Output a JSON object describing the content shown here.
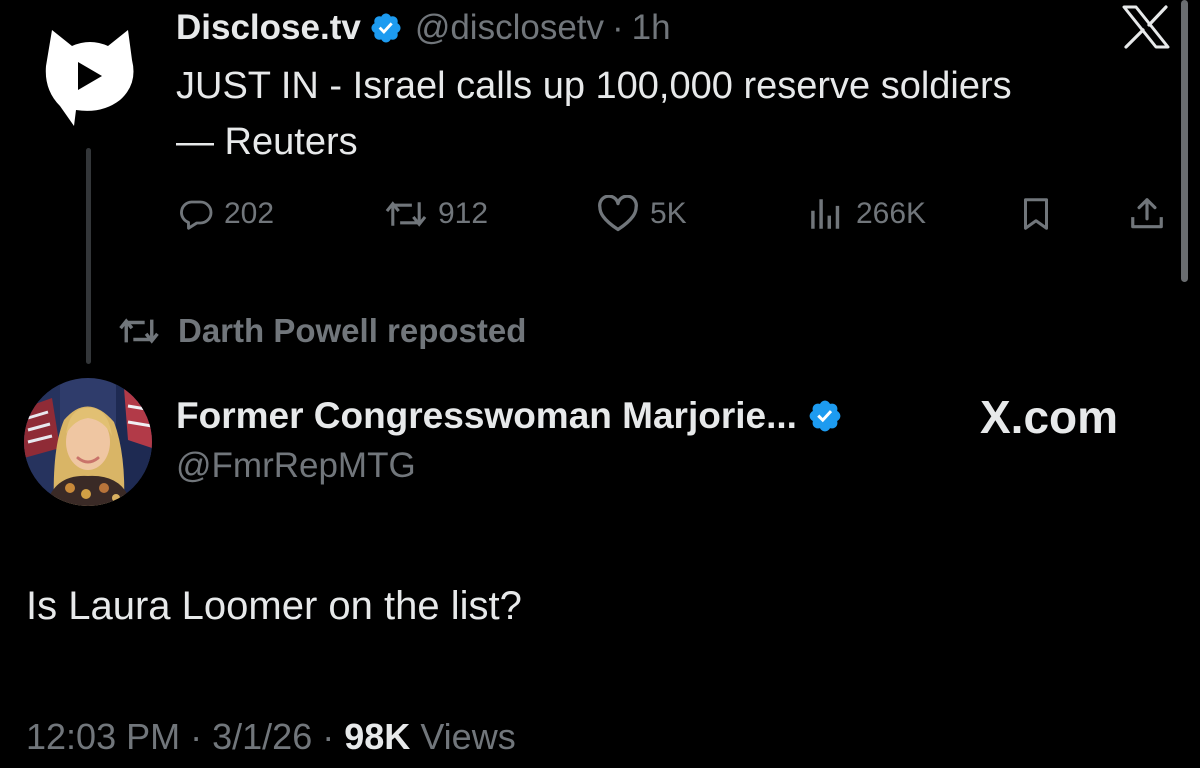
{
  "quoted_tweet": {
    "author_name": "Disclose.tv",
    "handle": "@disclosetv",
    "separator": "·",
    "time_ago": "1h",
    "text_line1": "JUST IN - Israel calls up 100,000 reserve soldiers",
    "text_line2": "— Reuters",
    "stats": {
      "replies": "202",
      "reposts": "912",
      "likes": "5K",
      "views": "266K"
    },
    "icons": [
      "disclose-logo",
      "verified-badge-icon",
      "x-logo-icon",
      "reply-icon",
      "repost-icon",
      "like-icon",
      "views-icon",
      "bookmark-icon",
      "share-icon"
    ]
  },
  "repost_banner": {
    "text": "Darth Powell reposted"
  },
  "main_tweet": {
    "author_name": "Former Congresswoman Marjorie...",
    "handle": "@FmrRepMTG",
    "brand_label": "X.com",
    "text": "Is Laura Loomer on the list?",
    "time": "12:03 PM",
    "date": "3/1/26",
    "separator": "·",
    "views_count": "98K",
    "views_label": "Views"
  },
  "colors": {
    "background": "#000000",
    "primary_text": "#e7e9ea",
    "secondary_text": "#71767b",
    "verified_blue": "#1d9bf0"
  }
}
